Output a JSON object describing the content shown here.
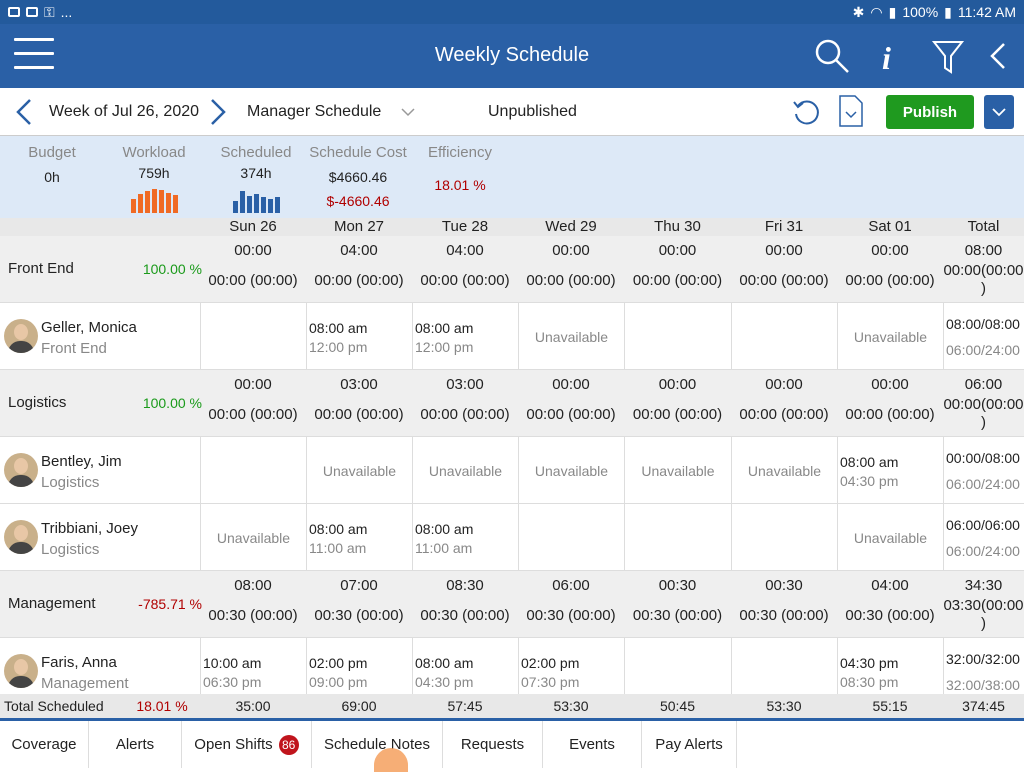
{
  "status_bar": {
    "left_more": "...",
    "battery": "100%",
    "time": "11:42 AM"
  },
  "appbar": {
    "title": "Weekly Schedule"
  },
  "toolbar": {
    "week": "Week of Jul 26, 2020",
    "schedule_type": "Manager Schedule",
    "status": "Unpublished",
    "publish_label": "Publish"
  },
  "metrics": {
    "budget": {
      "label": "Budget",
      "value": "0h"
    },
    "workload": {
      "label": "Workload",
      "value": "759h",
      "bar_levels": [
        0.6,
        0.8,
        0.9,
        1,
        0.95,
        0.85,
        0.75
      ]
    },
    "scheduled": {
      "label": "Scheduled",
      "value": "374h",
      "bar_levels": [
        0.5,
        0.9,
        0.7,
        0.8,
        0.65,
        0.6,
        0.65
      ]
    },
    "schedule_cost": {
      "label": "Schedule Cost",
      "value": "$4660.46",
      "value2": "$-4660.46"
    },
    "efficiency": {
      "label": "Efficiency",
      "value": "18.01 %"
    }
  },
  "days": [
    "Sun 26",
    "Mon 27",
    "Tue 28",
    "Wed 29",
    "Thu 30",
    "Fri 31",
    "Sat 01",
    "Total"
  ],
  "departments": [
    {
      "name": "Front End",
      "pct": "100.00 %",
      "cells": [
        [
          "00:00",
          "00:00 (00:00)"
        ],
        [
          "04:00",
          "00:00 (00:00)"
        ],
        [
          "04:00",
          "00:00 (00:00)"
        ],
        [
          "00:00",
          "00:00 (00:00)"
        ],
        [
          "00:00",
          "00:00 (00:00)"
        ],
        [
          "00:00",
          "00:00 (00:00)"
        ],
        [
          "00:00",
          "00:00 (00:00)"
        ],
        [
          "08:00",
          "00:00(00:00\n)"
        ]
      ]
    },
    {
      "name": "Logistics",
      "pct": "100.00 %",
      "cells": [
        [
          "00:00",
          "00:00 (00:00)"
        ],
        [
          "03:00",
          "00:00 (00:00)"
        ],
        [
          "03:00",
          "00:00 (00:00)"
        ],
        [
          "00:00",
          "00:00 (00:00)"
        ],
        [
          "00:00",
          "00:00 (00:00)"
        ],
        [
          "00:00",
          "00:00 (00:00)"
        ],
        [
          "00:00",
          "00:00 (00:00)"
        ],
        [
          "06:00",
          "00:00(00:00\n)"
        ]
      ]
    },
    {
      "name": "Management",
      "pct": "-785.71 %",
      "cells": [
        [
          "08:00",
          "00:30 (00:00)"
        ],
        [
          "07:00",
          "00:30 (00:00)"
        ],
        [
          "08:30",
          "00:30 (00:00)"
        ],
        [
          "06:00",
          "00:30 (00:00)"
        ],
        [
          "00:30",
          "00:30 (00:00)"
        ],
        [
          "00:30",
          "00:30 (00:00)"
        ],
        [
          "04:00",
          "00:30 (00:00)"
        ],
        [
          "34:30",
          "03:30(00:00\n)"
        ]
      ]
    }
  ],
  "employees": [
    {
      "name": "Geller, Monica",
      "dept": "Front End",
      "total1": "08:00/08:00",
      "total2": "06:00/24:00",
      "shifts": [
        null,
        [
          "08:00 am",
          "12:00 pm"
        ],
        [
          "08:00 am",
          "12:00 pm"
        ],
        "Unavailable",
        null,
        null,
        "Unavailable"
      ]
    },
    {
      "name": "Bentley, Jim",
      "dept": "Logistics",
      "total1": "00:00/08:00",
      "total2": "06:00/24:00",
      "shifts": [
        null,
        "Unavailable",
        "Unavailable",
        "Unavailable",
        "Unavailable",
        "Unavailable",
        [
          "08:00 am",
          "04:30 pm"
        ]
      ]
    },
    {
      "name": "Tribbiani, Joey",
      "dept": "Logistics",
      "total1": "06:00/06:00",
      "total2": "06:00/24:00",
      "shifts": [
        "Unavailable",
        [
          "08:00 am",
          "11:00 am"
        ],
        [
          "08:00 am",
          "11:00 am"
        ],
        null,
        null,
        null,
        "Unavailable"
      ]
    },
    {
      "name": "Faris, Anna",
      "dept": "Management",
      "total1": "32:00/32:00",
      "total2": "32:00/38:00",
      "shifts": [
        [
          "10:00 am",
          "06:30 pm"
        ],
        [
          "02:00 pm",
          "09:00 pm"
        ],
        [
          "08:00 am",
          "04:30 pm"
        ],
        [
          "02:00 pm",
          "07:30 pm"
        ],
        null,
        null,
        [
          "04:30 pm",
          "08:30 pm"
        ]
      ]
    }
  ],
  "total_scheduled": {
    "label": "Total Scheduled",
    "pct": "18.01 %",
    "values": [
      "35:00",
      "69:00",
      "57:45",
      "53:30",
      "50:45",
      "53:30",
      "55:15",
      "374:45"
    ]
  },
  "bottom_tabs": [
    "Coverage",
    "Alerts",
    "Open Shifts",
    "Schedule Notes",
    "Requests",
    "Events",
    "Pay Alerts"
  ],
  "open_shifts_badge": "86",
  "colors": {
    "appbar": "#2a60a6",
    "publish": "#1f9a1f",
    "negative": "#b00000",
    "positive": "#1a9a1a",
    "workload_bars": "#f06a24",
    "scheduled_bars": "#2a60a6"
  }
}
